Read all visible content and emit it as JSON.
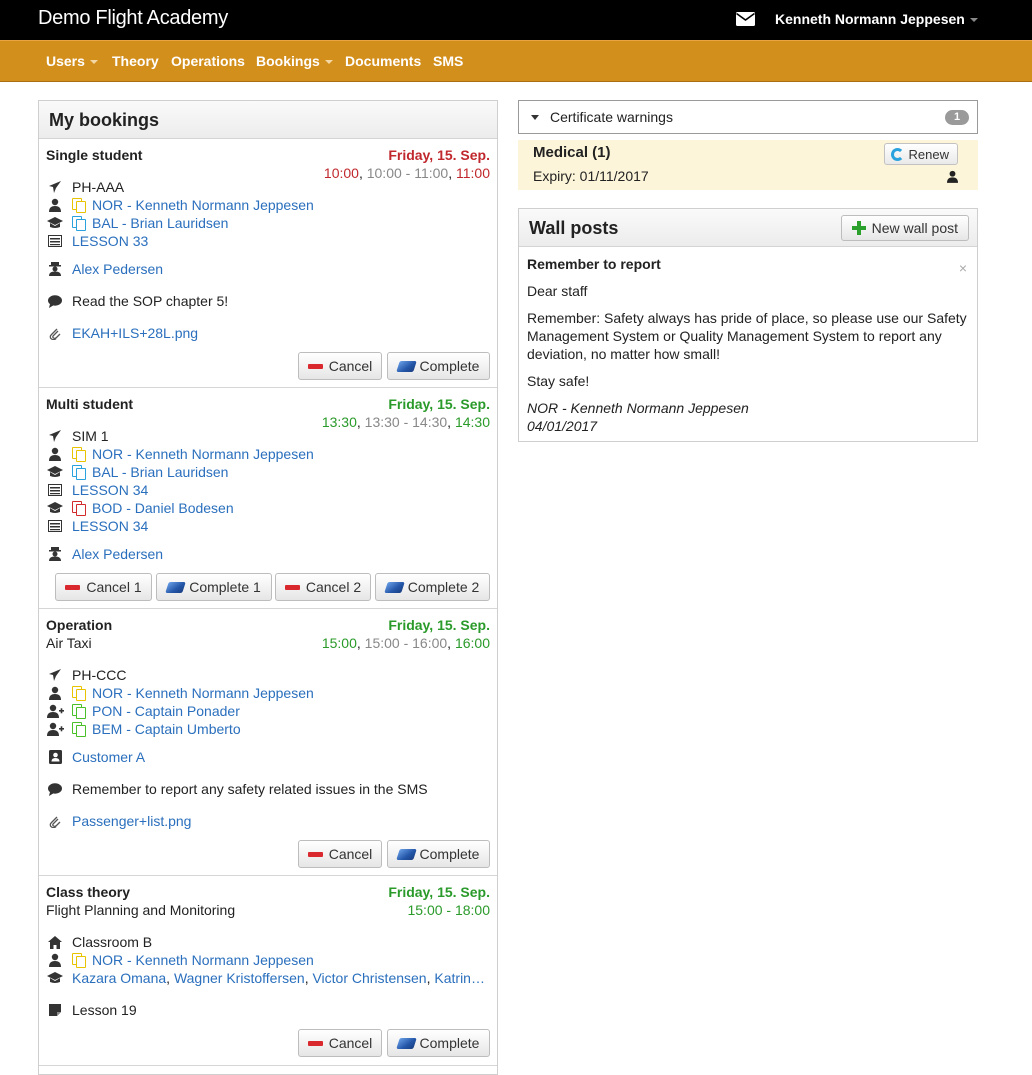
{
  "app": {
    "title": "Demo Flight Academy",
    "user_name": "Kenneth Normann Jeppesen",
    "mail_icon": "envelope-icon"
  },
  "nav": {
    "items": [
      "Users",
      "Theory",
      "Operations",
      "Bookings",
      "Documents",
      "SMS"
    ]
  },
  "my_bookings": {
    "title": "My bookings",
    "bookings": [
      {
        "type": "Single student",
        "date": "Friday, 15. Sep.",
        "time_start": "10:00",
        "time_range": "10:00 - 11:00",
        "time_end": "11:00",
        "aircraft": "PH-AAA",
        "instructor": "NOR - Kenneth Normann Jeppesen",
        "student": "BAL - Brian Lauridsen",
        "lesson": "LESSON 33",
        "supervisor": "Alex Pedersen",
        "comment": "Read the SOP chapter 5!",
        "attachment": "EKAH+ILS+28L.png",
        "cancel_label": "Cancel",
        "complete_label": "Complete"
      },
      {
        "type": "Multi student",
        "date": "Friday, 15. Sep.",
        "time_start": "13:30",
        "time_range": "13:30 - 14:30",
        "time_end": "14:30",
        "aircraft": "SIM 1",
        "instructor": "NOR - Kenneth Normann Jeppesen",
        "student1": "BAL - Brian Lauridsen",
        "lesson1": "LESSON 34",
        "student2": "BOD - Daniel Bodesen",
        "lesson2": "LESSON 34",
        "supervisor": "Alex Pedersen",
        "cancel1_label": "Cancel 1",
        "complete1_label": "Complete 1",
        "cancel2_label": "Cancel 2",
        "complete2_label": "Complete 2"
      },
      {
        "type": "Operation",
        "subtype": "Air Taxi",
        "date": "Friday, 15. Sep.",
        "time_start": "15:00",
        "time_range": "15:00 - 16:00",
        "time_end": "16:00",
        "aircraft": "PH-CCC",
        "pilot": "NOR - Kenneth Normann Jeppesen",
        "crew1": "PON - Captain Ponader",
        "crew2": "BEM - Captain Umberto",
        "customer": "Customer A",
        "comment": "Remember to report any safety related issues in the SMS",
        "attachment": "Passenger+list.png",
        "cancel_label": "Cancel",
        "complete_label": "Complete"
      },
      {
        "type": "Class theory",
        "subtype": "Flight Planning and Monitoring",
        "date": "Friday, 15. Sep.",
        "time_range": "15:00 - 18:00",
        "location": "Classroom B",
        "instructor": "NOR - Kenneth Normann Jeppesen",
        "students": [
          "Kazara Omana",
          "Wagner Kristoffersen",
          "Victor Christensen",
          "Katrin…"
        ],
        "note": "Lesson 19",
        "cancel_label": "Cancel",
        "complete_label": "Complete"
      }
    ]
  },
  "certificate_warnings": {
    "title": "Certificate warnings",
    "count": "1",
    "item_title": "Medical (1)",
    "expiry": "Expiry: 01/11/2017",
    "renew_label": "Renew"
  },
  "wall_posts": {
    "title": "Wall posts",
    "new_label": "New wall post",
    "post": {
      "title": "Remember to report",
      "greeting": "Dear staff",
      "body": "Remember: Safety always has pride of place, so please use our Safety Management System or Quality Management System to report any deviation, no matter how small!",
      "closing": "Stay safe!",
      "author": "NOR - Kenneth Normann Jeppesen",
      "date": "04/01/2017",
      "close_glyph": "×"
    }
  },
  "colors": {
    "nav_bg": "#d38f1c",
    "date_red": "#c0282d",
    "date_green": "#2a9a2a",
    "link": "#2a6fbd"
  }
}
